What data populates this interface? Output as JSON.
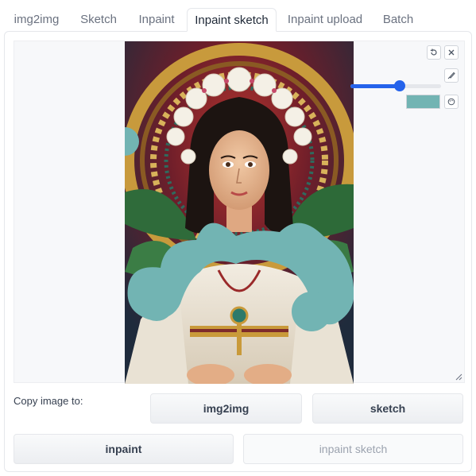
{
  "tabs": [
    {
      "label": "img2img",
      "active": false
    },
    {
      "label": "Sketch",
      "active": false
    },
    {
      "label": "Inpaint",
      "active": false
    },
    {
      "label": "Inpaint sketch",
      "active": true
    },
    {
      "label": "Inpaint upload",
      "active": false
    },
    {
      "label": "Batch",
      "active": false
    }
  ],
  "canvas": {
    "brush_size_fraction": 0.55,
    "brush_color": "#72b4b3",
    "tools": [
      "undo-icon",
      "clear-icon",
      "brush-icon",
      "palette-icon"
    ]
  },
  "copy": {
    "label": "Copy image to:",
    "img2img": "img2img",
    "sketch": "sketch",
    "inpaint": "inpaint",
    "inpaint_sketch": "inpaint sketch"
  },
  "colors": {
    "accent": "#2563eb",
    "mask": "#72b4b3"
  }
}
